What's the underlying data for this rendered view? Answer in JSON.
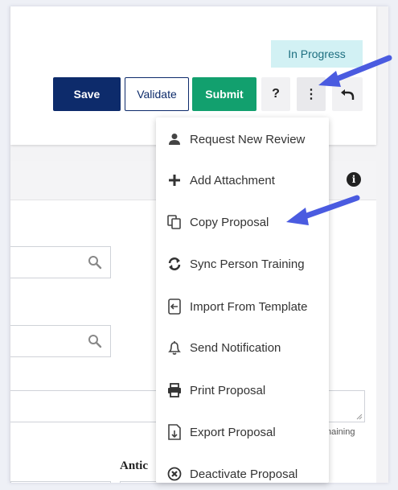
{
  "header": {
    "status": "In Progress",
    "save_label": "Save",
    "validate_label": "Validate",
    "submit_label": "Submit",
    "help_label": "?",
    "more_label": "⋮"
  },
  "menu": {
    "items": [
      {
        "label": "Request New Review",
        "icon": "user-icon"
      },
      {
        "label": "Add Attachment",
        "icon": "plus-icon"
      },
      {
        "label": "Copy Proposal",
        "icon": "copy-icon"
      },
      {
        "label": "Sync Person Training",
        "icon": "sync-icon"
      },
      {
        "label": "Import From Template",
        "icon": "import-icon"
      },
      {
        "label": "Send Notification",
        "icon": "bell-icon"
      },
      {
        "label": "Print Proposal",
        "icon": "print-icon"
      },
      {
        "label": "Export Proposal",
        "icon": "export-icon"
      },
      {
        "label": "Deactivate Proposal",
        "icon": "deactivate-icon"
      }
    ]
  },
  "form": {
    "remaining_text": "naining",
    "anticipated_label": "Antic"
  },
  "colors": {
    "primary": "#0d2b6b",
    "submit": "#12a06e",
    "status_bg": "#d2f1f4",
    "annotation_arrow": "#4a5be0"
  }
}
